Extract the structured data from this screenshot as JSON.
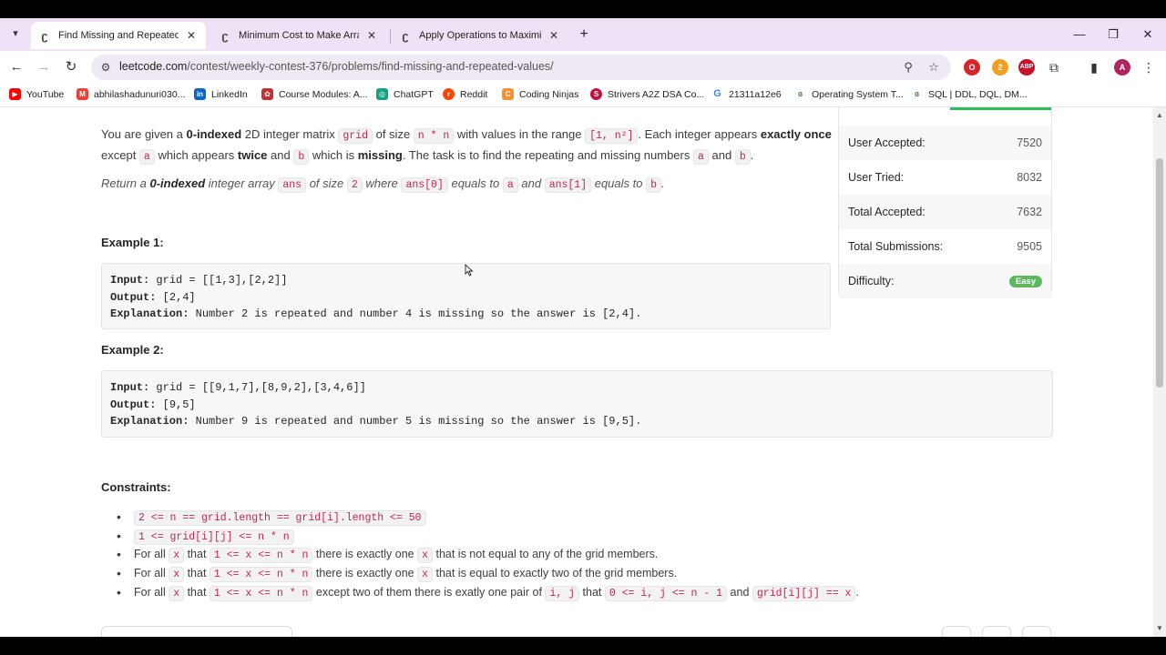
{
  "browser": {
    "tabs": [
      {
        "title": "Find Missing and Repeated Valu",
        "active": true
      },
      {
        "title": "Minimum Cost to Make Array E",
        "active": false
      },
      {
        "title": "Apply Operations to Maximize",
        "active": false
      }
    ],
    "url_host": "leetcode.com",
    "url_path": "/contest/weekly-contest-376/problems/find-missing-and-repeated-values/",
    "bookmarks": [
      {
        "label": "YouTube",
        "icon": "youtube-icon",
        "color": "#ff0000"
      },
      {
        "label": "abhilashadunuri030...",
        "icon": "gmail-icon",
        "color": "#ea4335"
      },
      {
        "label": "LinkedIn",
        "icon": "linkedin-icon",
        "color": "#0a66c2"
      },
      {
        "label": "Course Modules: A...",
        "icon": "course-icon",
        "color": "#b33"
      },
      {
        "label": "ChatGPT",
        "icon": "chatgpt-icon",
        "color": "#10a37f"
      },
      {
        "label": "Reddit",
        "icon": "reddit-icon",
        "color": "#ff4500"
      },
      {
        "label": "Coding Ninjas",
        "icon": "coding-ninjas-icon",
        "color": "#f79032"
      },
      {
        "label": "Strivers A2Z DSA Co...",
        "icon": "striver-icon",
        "color": "#c0143c"
      },
      {
        "label": "21311a12e6",
        "icon": "google-icon",
        "color": "#4285f4"
      },
      {
        "label": "Operating System T...",
        "icon": "gfg-icon",
        "color": "#2f8d46"
      },
      {
        "label": "SQL | DDL, DQL, DM...",
        "icon": "gfg-icon",
        "color": "#2f8d46"
      }
    ],
    "profile_initial": "A",
    "ext_badge": "2"
  },
  "problem": {
    "p1": {
      "t1": "You are given a ",
      "b1": "0-indexed",
      "t2": " 2D integer matrix ",
      "c1": "grid",
      "t3": " of size ",
      "c2": "n * n",
      "t4": " with values in the range ",
      "c3": "[1, n²]",
      "t5": ". Each integer appears ",
      "b2": "exactly once",
      "t6": "except ",
      "c4": "a",
      "t7": " which appears ",
      "b3": "twice",
      "t8": " and ",
      "c5": "b",
      "t9": " which is ",
      "b4": "missing",
      "t10": ". The task is to find the repeating and missing numbers ",
      "c6": "a",
      "t11": " and ",
      "c7": "b",
      "t12": "."
    },
    "p2": {
      "t1": "Return a ",
      "b1": "0-indexed",
      "t2": " integer array ",
      "c1": "ans",
      "t3": " of size ",
      "c2": "2",
      "t4": " where ",
      "c3": "ans[0]",
      "t5": " equals to ",
      "c4": "a",
      "t6": " and ",
      "c5": "ans[1]",
      "t7": " equals to ",
      "c6": "b",
      "t8": "."
    },
    "examples": [
      {
        "title": "Example 1:",
        "input_label": "Input:",
        "input": " grid = [[1,3],[2,2]]",
        "output_label": "Output:",
        "output": " [2,4]",
        "explanation_label": "Explanation:",
        "explanation": " Number 2 is repeated and number 4 is missing so the answer is [2,4]."
      },
      {
        "title": "Example 2:",
        "input_label": "Input:",
        "input": " grid = [[9,1,7],[8,9,2],[3,4,6]]",
        "output_label": "Output:",
        "output": " [9,5]",
        "explanation_label": "Explanation:",
        "explanation": " Number 9 is repeated and number 5 is missing so the answer is [9,5]."
      }
    ],
    "constraints_title": "Constraints:",
    "constraints": {
      "c1": "2 <= n == grid.length == grid[i].length <= 50",
      "c2": "1 <= grid[i][j] <= n * n",
      "c3": {
        "t1": "For all ",
        "x1": "x",
        "t2": " that ",
        "r": "1 <= x <= n * n",
        "t3": " there is exactly one ",
        "x2": "x",
        "t4": " that is not equal to any of the grid members."
      },
      "c4": {
        "t1": "For all ",
        "x1": "x",
        "t2": " that ",
        "r": "1 <= x <= n * n",
        "t3": " there is exactly one ",
        "x2": "x",
        "t4": " that is equal to exactly two of the grid members."
      },
      "c5": {
        "t1": "For all ",
        "x1": "x",
        "t2": " that ",
        "r": "1 <= x <= n * n",
        "t3": " except two of them there is exatly one pair of ",
        "ij": "i, j",
        "t4": " that ",
        "r2": "0 <= i, j <= n - 1",
        "t5": " and ",
        "g": "grid[i][j] == x",
        "t6": "."
      }
    }
  },
  "stats": {
    "rows": [
      {
        "label": "User Accepted:",
        "value": "7520"
      },
      {
        "label": "User Tried:",
        "value": "8032"
      },
      {
        "label": "Total Accepted:",
        "value": "7632"
      },
      {
        "label": "Total Submissions:",
        "value": "9505"
      }
    ],
    "difficulty_label": "Difficulty:",
    "difficulty": "Easy"
  }
}
